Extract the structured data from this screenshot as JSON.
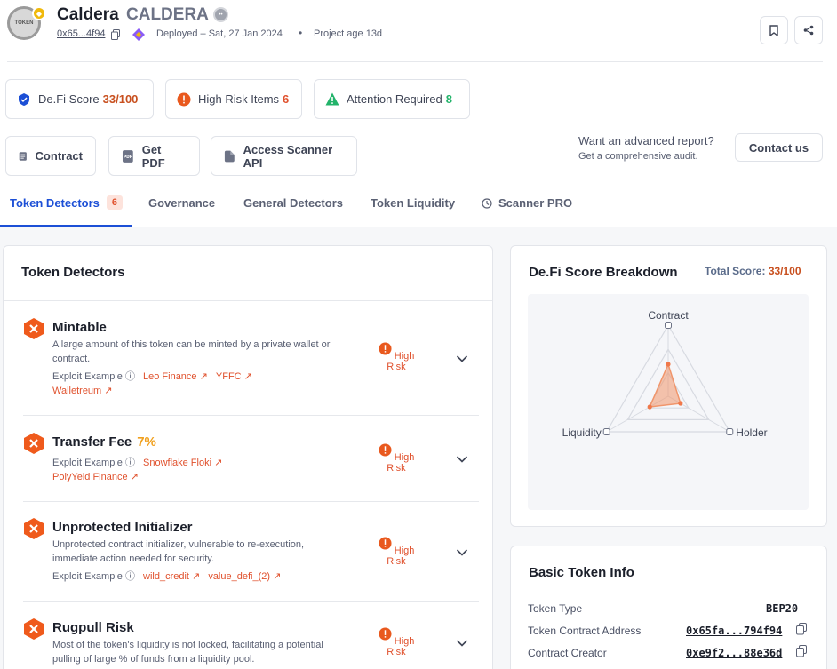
{
  "header": {
    "token_name": "Caldera",
    "token_symbol": "CALDERA",
    "logo_text": "TOKEN",
    "address_short": "0x65...4f94",
    "deployed": "Deployed – Sat, 27 Jan 2024",
    "separator": "•",
    "project_age": "Project age 13d"
  },
  "scores": {
    "defi_label": "De.Fi Score",
    "defi_value": "33/100",
    "high_risk_label": "High Risk Items",
    "high_risk_value": "6",
    "attention_label": "Attention Required",
    "attention_value": "8"
  },
  "actions": {
    "contract": "Contract",
    "pdf": "Get PDF",
    "api": "Access Scanner API",
    "adv_title": "Want an advanced report?",
    "adv_sub": "Get a comprehensive audit.",
    "contact": "Contact us"
  },
  "tabs": [
    {
      "label": "Token Detectors",
      "count": "6"
    },
    {
      "label": "Governance"
    },
    {
      "label": "General Detectors"
    },
    {
      "label": "Token Liquidity"
    },
    {
      "label": "Scanner PRO"
    }
  ],
  "detectors_card": {
    "title": "Token Detectors",
    "exploit_label": "Exploit Example",
    "risk_label": "High Risk",
    "items": [
      {
        "title": "Mintable",
        "desc": "A large amount of this token can be minted by a private wallet or contract.",
        "links": [
          "Leo Finance",
          "YFFC",
          "Walletreum"
        ]
      },
      {
        "title": "Transfer Fee",
        "pct": "7%",
        "links": [
          "Snowflake Floki",
          "PolyYeld Finance"
        ]
      },
      {
        "title": "Unprotected Initializer",
        "desc": "Unprotected contract initializer, vulnerable to re-execution, immediate action needed for security.",
        "links": [
          "wild_credit",
          "value_defi_(2)"
        ]
      },
      {
        "title": "Rugpull Risk",
        "desc": "Most of the token's liquidity is not locked, facilitating a potential pulling of large % of funds from a liquidity pool."
      }
    ]
  },
  "breakdown": {
    "title": "De.Fi Score Breakdown",
    "total_label": "Total Score:",
    "total_value": "33/100",
    "axes": [
      "Contract",
      "Liquidity",
      "Holder"
    ]
  },
  "chart_data": {
    "type": "radar",
    "title": "De.Fi Score Breakdown",
    "axes": [
      "Contract",
      "Holder",
      "Liquidity"
    ],
    "values": [
      0.45,
      0.2,
      0.3
    ],
    "range": [
      0,
      1
    ],
    "color": "#f0956b"
  },
  "basic_info": {
    "title": "Basic Token Info",
    "rows": [
      {
        "label": "Token Type",
        "value": "BEP20"
      },
      {
        "label": "Token Contract Address",
        "value": "0x65fa...794f94"
      },
      {
        "label": "Contract Creator",
        "value": "0xe9f2...88e36d"
      }
    ]
  },
  "colors": {
    "accent": "#1c4fd6",
    "danger": "#e0512d",
    "success": "#22b36a",
    "warning": "#f0a01e"
  }
}
